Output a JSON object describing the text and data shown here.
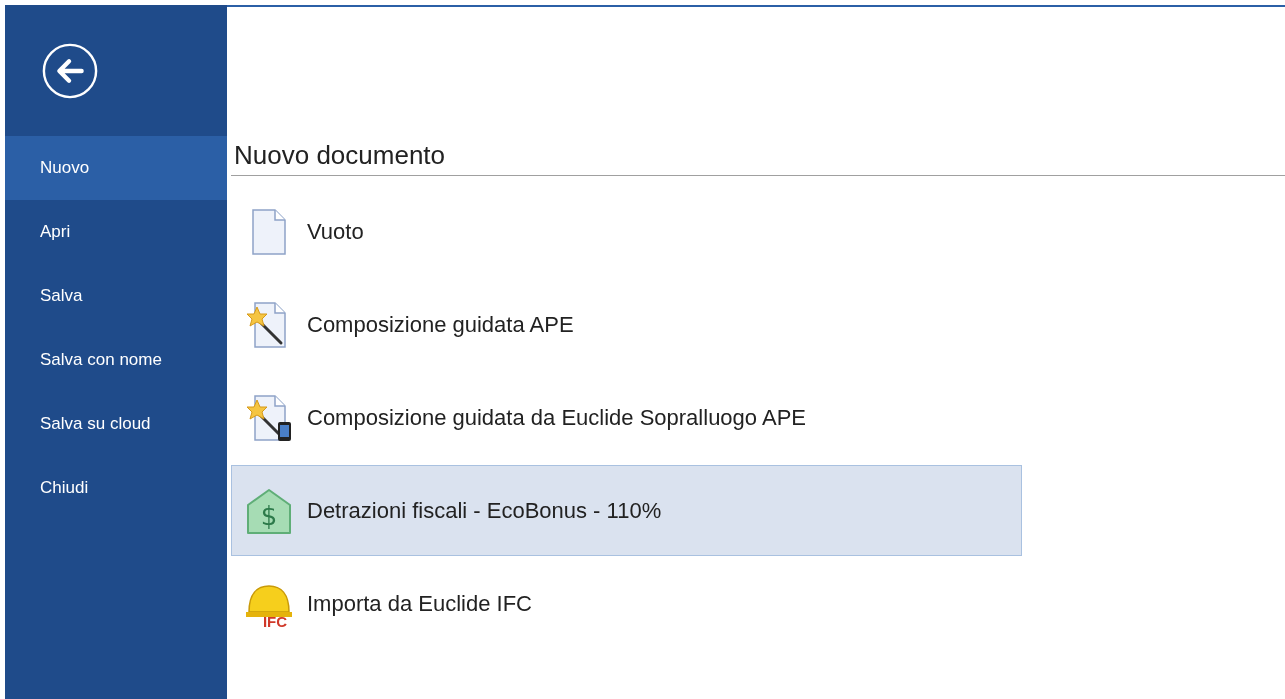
{
  "sidebar": {
    "items": [
      {
        "label": "Nuovo",
        "selected": true
      },
      {
        "label": "Apri",
        "selected": false
      },
      {
        "label": "Salva",
        "selected": false
      },
      {
        "label": "Salva con nome",
        "selected": false
      },
      {
        "label": "Salva su cloud",
        "selected": false
      },
      {
        "label": "Chiudi",
        "selected": false
      }
    ]
  },
  "main": {
    "title": "Nuovo documento",
    "items": [
      {
        "kind": "blank",
        "label": "Vuoto",
        "selected": false
      },
      {
        "kind": "wizard",
        "label": "Composizione guidata APE",
        "selected": false
      },
      {
        "kind": "wizard-mobile",
        "label": "Composizione guidata da Euclide Sopralluogo APE",
        "selected": false
      },
      {
        "kind": "house",
        "label": "Detrazioni fiscali - EcoBonus - 110%",
        "icon_text": "$",
        "selected": true
      },
      {
        "kind": "helmet",
        "label": "Importa da Euclide IFC",
        "icon_text": "IFC",
        "selected": false
      }
    ]
  }
}
